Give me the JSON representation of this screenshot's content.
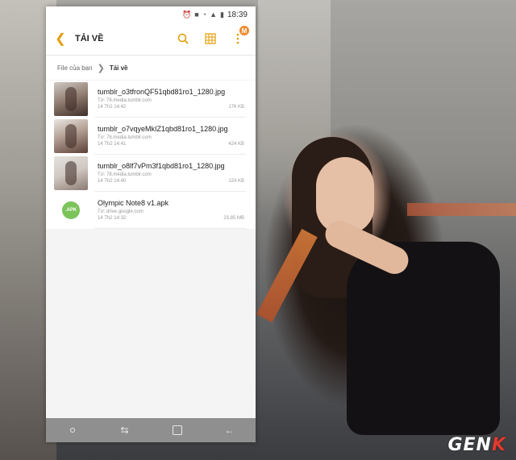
{
  "status": {
    "time": "18:39",
    "icons": [
      "alarm-icon",
      "notification-icon",
      "wifi-icon",
      "signal-icon",
      "battery-icon"
    ]
  },
  "appbar": {
    "back_icon": "chevron-left-icon",
    "title": "TẢI VỀ",
    "badge": "M"
  },
  "breadcrumb": {
    "root": "File của bạn",
    "current": "Tải về"
  },
  "files": [
    {
      "name": "tumblr_o3tfronQF51qbd81ro1_1280.jpg",
      "source": "Từ: 78.media.tumblr.com",
      "date": "14 Th2 14:42",
      "size": "176 KB"
    },
    {
      "name": "tumblr_o7vqyeMkIZ1qbd81ro1_1280.jpg",
      "source": "Từ: 78.media.tumblr.com",
      "date": "14 Th2 14:41",
      "size": "424 KB"
    },
    {
      "name": "tumblr_o8lf7vPm3f1qbd81ro1_1280.jpg",
      "source": "Từ: 78.media.tumblr.com",
      "date": "14 Th2 14:40",
      "size": "124 KB"
    },
    {
      "name": "Olympic Note8 v1.apk",
      "source": "Từ: drive.google.com",
      "date": "14 Th2 14:32",
      "size": "23,85 MB",
      "icon_label": ".APK"
    }
  ],
  "watermark": {
    "prefix": "GEN",
    "suffix": "K"
  },
  "colors": {
    "accent": "#e39b00",
    "apk_green": "#7cc35a",
    "navbar": "#8f8f8f"
  }
}
